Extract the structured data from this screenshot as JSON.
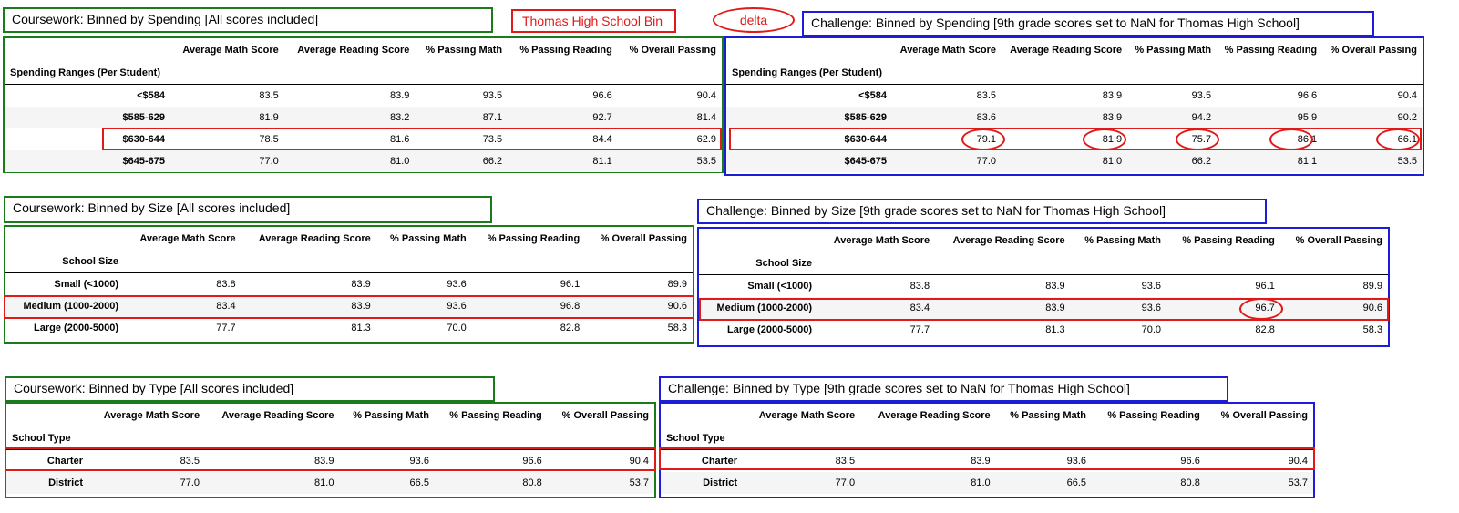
{
  "legend": {
    "bin_label": "Thomas High School Bin",
    "delta_label": "delta"
  },
  "headers": [
    "Average Math Score",
    "Average Reading Score",
    "% Passing Math",
    "% Passing Reading",
    "% Overall Passing"
  ],
  "spending": {
    "coursework_title": "Coursework: Binned by Spending [All scores included]",
    "challenge_title": "Challenge:  Binned by Spending [9th grade scores set to NaN for Thomas High School]",
    "index_label": "Spending Ranges (Per Student)",
    "coursework_rows": [
      [
        "<$584",
        "83.5",
        "83.9",
        "93.5",
        "96.6",
        "90.4"
      ],
      [
        "$585-629",
        "81.9",
        "83.2",
        "87.1",
        "92.7",
        "81.4"
      ],
      [
        "$630-644",
        "78.5",
        "81.6",
        "73.5",
        "84.4",
        "62.9"
      ],
      [
        "$645-675",
        "77.0",
        "81.0",
        "66.2",
        "81.1",
        "53.5"
      ]
    ],
    "challenge_rows": [
      [
        "<$584",
        "83.5",
        "83.9",
        "93.5",
        "96.6",
        "90.4"
      ],
      [
        "$585-629",
        "83.6",
        "83.9",
        "94.2",
        "95.9",
        "90.2"
      ],
      [
        "$630-644",
        "79.1",
        "81.9",
        "75.7",
        "86.1",
        "66.1"
      ],
      [
        "$645-675",
        "77.0",
        "81.0",
        "66.2",
        "81.1",
        "53.5"
      ]
    ]
  },
  "size": {
    "coursework_title": "Coursework: Binned by Size [All scores included]",
    "challenge_title": "Challenge:  Binned by Size [9th grade scores set to NaN for Thomas High School]",
    "index_label": "School Size",
    "coursework_rows": [
      [
        "Small (<1000)",
        "83.8",
        "83.9",
        "93.6",
        "96.1",
        "89.9"
      ],
      [
        "Medium (1000-2000)",
        "83.4",
        "83.9",
        "93.6",
        "96.8",
        "90.6"
      ],
      [
        "Large (2000-5000)",
        "77.7",
        "81.3",
        "70.0",
        "82.8",
        "58.3"
      ]
    ],
    "challenge_rows": [
      [
        "Small (<1000)",
        "83.8",
        "83.9",
        "93.6",
        "96.1",
        "89.9"
      ],
      [
        "Medium (1000-2000)",
        "83.4",
        "83.9",
        "93.6",
        "96.7",
        "90.6"
      ],
      [
        "Large (2000-5000)",
        "77.7",
        "81.3",
        "70.0",
        "82.8",
        "58.3"
      ]
    ]
  },
  "type": {
    "coursework_title": "Coursework: Binned by Type [All scores included]",
    "challenge_title": "Challenge:  Binned by Type [9th grade scores set to NaN for Thomas High School]",
    "index_label": "School Type",
    "coursework_rows": [
      [
        "Charter",
        "83.5",
        "83.9",
        "93.6",
        "96.6",
        "90.4"
      ],
      [
        "District",
        "77.0",
        "81.0",
        "66.5",
        "80.8",
        "53.7"
      ]
    ],
    "challenge_rows": [
      [
        "Charter",
        "83.5",
        "83.9",
        "93.6",
        "96.6",
        "90.4"
      ],
      [
        "District",
        "77.0",
        "81.0",
        "66.5",
        "80.8",
        "53.7"
      ]
    ]
  },
  "colors": {
    "coursework": "#1b7a1b",
    "challenge": "#1d1dd6",
    "highlight": "#e01919"
  }
}
